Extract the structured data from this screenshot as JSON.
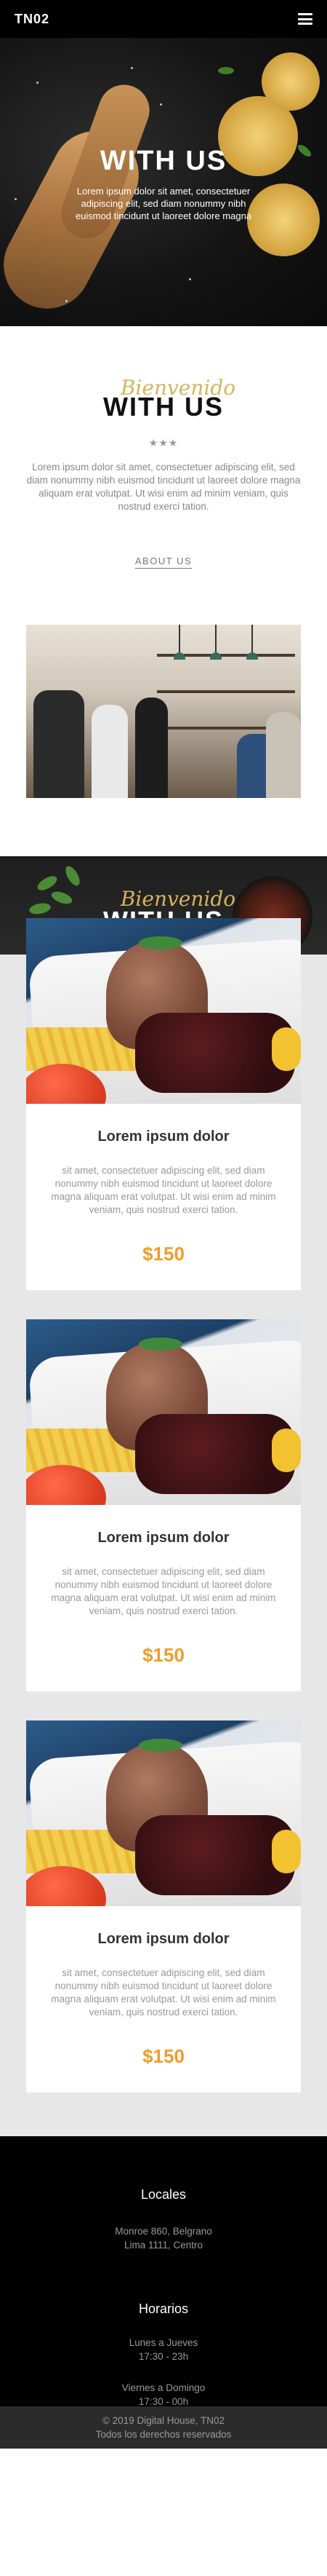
{
  "nav": {
    "brand": "TN02",
    "menu_icon": "hamburger-menu-icon"
  },
  "hero": {
    "title": "WITH US",
    "text": "Lorem ipsum dolor sit amet, consectetuer adipiscing elit, sed diam nonummy nibh euismod tincidunt ut laoreet dolore magna"
  },
  "about": {
    "script_title": "Bienvenido",
    "title": "WITH US",
    "stars": "★★★",
    "text": "Lorem ipsum dolor sit amet, consectetuer adipiscing elit, sed diam nonummy nibh euismod tincidunt ut laoreet dolore magna aliquam erat volutpat. Ut wisi enim ad minim veniam, quis nostrud exerci tation.",
    "link": "ABOUT US"
  },
  "menu": {
    "script_title": "Bienvenido",
    "title": "WITH US",
    "items": [
      {
        "title": "Lorem ipsum dolor",
        "desc": "sit amet, consectetuer adipiscing elit, sed diam nonummy nibh euismod tincidunt ut laoreet dolore magna aliquam erat volutpat. Ut wisi enim ad minim veniam, quis nostrud exerci tation.",
        "price": "$150"
      },
      {
        "title": "Lorem ipsum dolor",
        "desc": "sit amet, consectetuer adipiscing elit, sed diam nonummy nibh euismod tincidunt ut laoreet dolore magna aliquam erat volutpat. Ut wisi enim ad minim veniam, quis nostrud exerci tation.",
        "price": "$150"
      },
      {
        "title": "Lorem ipsum dolor",
        "desc": "sit amet, consectetuer adipiscing elit, sed diam nonummy nibh euismod tincidunt ut laoreet dolore magna aliquam erat volutpat. Ut wisi enim ad minim veniam, quis nostrud exerci tation.",
        "price": "$150"
      }
    ]
  },
  "footer": {
    "locales_title": "Locales",
    "locales_line1": "Monroe 860, Belgrano",
    "locales_line2": "Lima 1111, Centro",
    "hours_title": "Horarios",
    "hours_weekday_days": "Lunes a Jueves",
    "hours_weekday_time": "17:30 - 23h",
    "hours_weekend_days": "Viernes a Domingo",
    "hours_weekend_time": "17:30 - 00h",
    "copy_line1": "© 2019 Digital House, TN02",
    "copy_line2": "Todos los derechos reservados"
  },
  "colors": {
    "accent_gold": "#d6b35e",
    "price_orange": "#f29b2b"
  }
}
